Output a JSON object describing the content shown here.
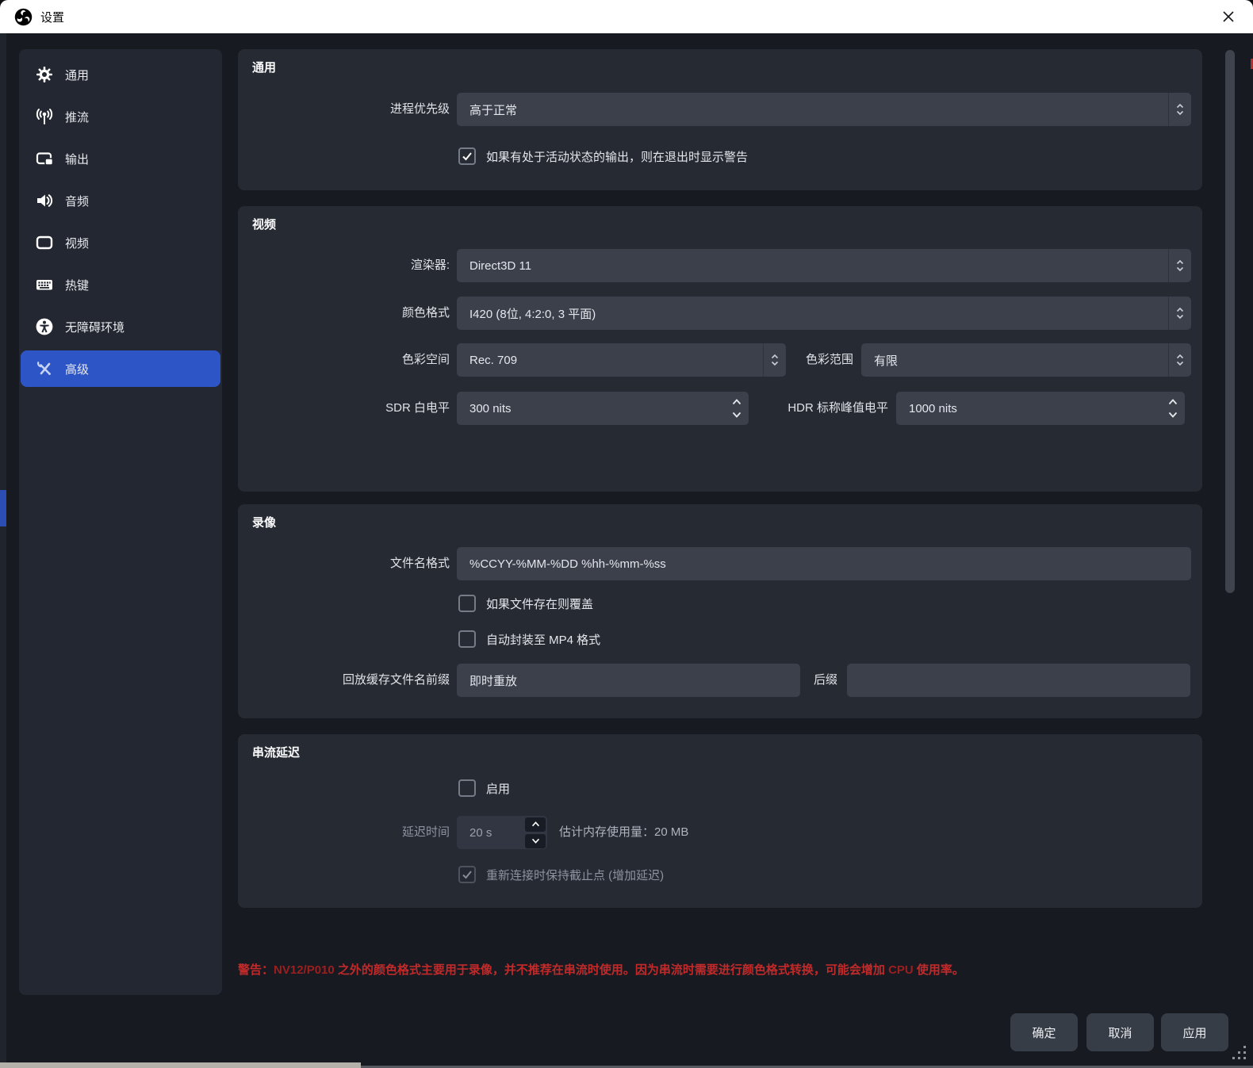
{
  "window": {
    "title": "设置"
  },
  "sidebar": {
    "items": [
      {
        "label": "通用",
        "icon": "gear-icon",
        "selected": false
      },
      {
        "label": "推流",
        "icon": "broadcast-icon",
        "selected": false
      },
      {
        "label": "输出",
        "icon": "output-icon",
        "selected": false
      },
      {
        "label": "音频",
        "icon": "audio-icon",
        "selected": false
      },
      {
        "label": "视频",
        "icon": "video-icon",
        "selected": false
      },
      {
        "label": "热键",
        "icon": "hotkeys-icon",
        "selected": false
      },
      {
        "label": "无障碍环境",
        "icon": "accessibility-icon",
        "selected": false
      },
      {
        "label": "高级",
        "icon": "advanced-tools-icon",
        "selected": true
      }
    ]
  },
  "general": {
    "title": "通用",
    "process_priority_label": "进程优先级",
    "process_priority_value": "高于正常",
    "warn_on_exit_label": "如果有处于活动状态的输出，则在退出时显示警告",
    "warn_on_exit_checked": true
  },
  "video": {
    "title": "视频",
    "renderer_label": "渲染器:",
    "renderer_value": "Direct3D 11",
    "color_format_label": "颜色格式",
    "color_format_value": "I420 (8位, 4:2:0, 3 平面)",
    "color_space_label": "色彩空间",
    "color_space_value": "Rec. 709",
    "color_range_label": "色彩范围",
    "color_range_value": "有限",
    "sdr_white_label": "SDR 白电平",
    "sdr_white_value": "300 nits",
    "hdr_peak_label": "HDR 标称峰值电平",
    "hdr_peak_value": "1000 nits"
  },
  "recording": {
    "title": "录像",
    "filename_label": "文件名格式",
    "filename_value": "%CCYY-%MM-%DD %hh-%mm-%ss",
    "overwrite_label": "如果文件存在则覆盖",
    "overwrite_checked": false,
    "remux_label": "自动封装至 MP4 格式",
    "remux_checked": false,
    "replay_prefix_label": "回放缓存文件名前缀",
    "replay_prefix_value": "即时重放",
    "suffix_label": "后缀",
    "suffix_value": ""
  },
  "stream_delay": {
    "title": "串流延迟",
    "enable_label": "启用",
    "enable_checked": false,
    "duration_label": "延迟时间",
    "duration_value": "20 s",
    "memory_note": "估计内存使用量：20 MB",
    "preserve_label": "重新连接时保持截止点 (增加延迟)",
    "preserve_checked": true
  },
  "warning": {
    "prefix": "警告：",
    "bold1": "NV12/P010",
    "text1": " 之外的颜色格式主要用于录像，并不推荐在串流时使用。因为串流时需要进行颜色格式转换，可能会增加 ",
    "bold2": "CPU",
    "text2": " 使用率。"
  },
  "footer": {
    "ok": "确定",
    "cancel": "取消",
    "apply": "应用"
  },
  "colors": {
    "titlebar_bg": "#ffffff",
    "window_bg": "#171a21",
    "panel_bg": "#262a33",
    "sidebar_bg": "#232731",
    "input_bg": "#3b404b",
    "accent_selected": "#2e55c6",
    "warning_red": "#c22a2a",
    "button_bg": "#373d47"
  }
}
